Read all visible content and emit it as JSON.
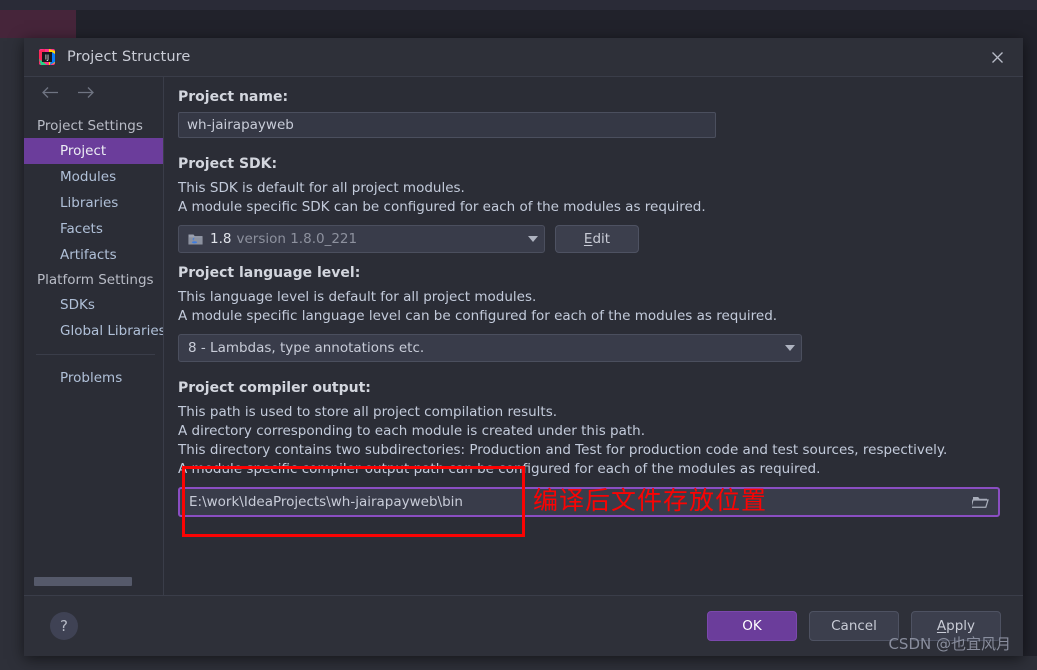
{
  "window": {
    "title": "Project Structure",
    "app_icon": "intellij-idea-icon",
    "close_icon": "close-icon",
    "nav_back_icon": "arrow-left-icon",
    "nav_forward_icon": "arrow-right-icon"
  },
  "sidebar": {
    "groups": [
      {
        "label": "Project Settings",
        "items": [
          {
            "label": "Project",
            "selected": true
          },
          {
            "label": "Modules",
            "selected": false
          },
          {
            "label": "Libraries",
            "selected": false
          },
          {
            "label": "Facets",
            "selected": false
          },
          {
            "label": "Artifacts",
            "selected": false
          }
        ]
      },
      {
        "label": "Platform Settings",
        "items": [
          {
            "label": "SDKs",
            "selected": false
          },
          {
            "label": "Global Libraries",
            "selected": false
          }
        ]
      }
    ],
    "extra": [
      {
        "label": "Problems"
      }
    ]
  },
  "main": {
    "project_name": {
      "heading": "Project name:",
      "value": "wh-jairapayweb"
    },
    "project_sdk": {
      "heading": "Project SDK:",
      "desc_line1": "This SDK is default for all project modules.",
      "desc_line2": "A module specific SDK can be configured for each of the modules as required.",
      "sdk_icon": "java-sdk-folder-icon",
      "selected_name": "1.8",
      "selected_version": "version 1.8.0_221",
      "dropdown_icon": "chevron-down-icon",
      "edit_label_pre": "",
      "edit_label_mnemonic": "E",
      "edit_label_post": "dit"
    },
    "language_level": {
      "heading": "Project language level:",
      "desc_line1": "This language level is default for all project modules.",
      "desc_line2": "A module specific language level can be configured for each of the modules as required.",
      "selected": "8 - Lambdas, type annotations etc.",
      "dropdown_icon": "chevron-down-icon"
    },
    "compiler_output": {
      "heading": "Project compiler output:",
      "desc_line1": "This path is used to store all project compilation results.",
      "desc_line2": "A directory corresponding to each module is created under this path.",
      "desc_line3": "This directory contains two subdirectories: Production and Test for production code and test sources, respectively.",
      "desc_line4": "A module specific compiler output path can be configured for each of the modules as required.",
      "path_value": "E:\\work\\IdeaProjects\\wh-jairapayweb\\bin",
      "browse_icon": "folder-open-icon"
    }
  },
  "annotation": {
    "text": "编译后文件存放位置",
    "color": "#fb0303"
  },
  "footer": {
    "help_label": "?",
    "help_icon": "question-mark-icon",
    "ok_label": "OK",
    "cancel_label": "Cancel",
    "apply_label_mnemonic": "A",
    "apply_label_post": "pply"
  },
  "watermark": {
    "text": "CSDN @也宜风月"
  },
  "colors": {
    "accent_purple": "#6b3d9b",
    "focus_purple": "#8a4ec2",
    "annotation_red": "#fb0303",
    "dialog_bg": "#2b2d36",
    "titlebar_bg": "#2e3039"
  }
}
